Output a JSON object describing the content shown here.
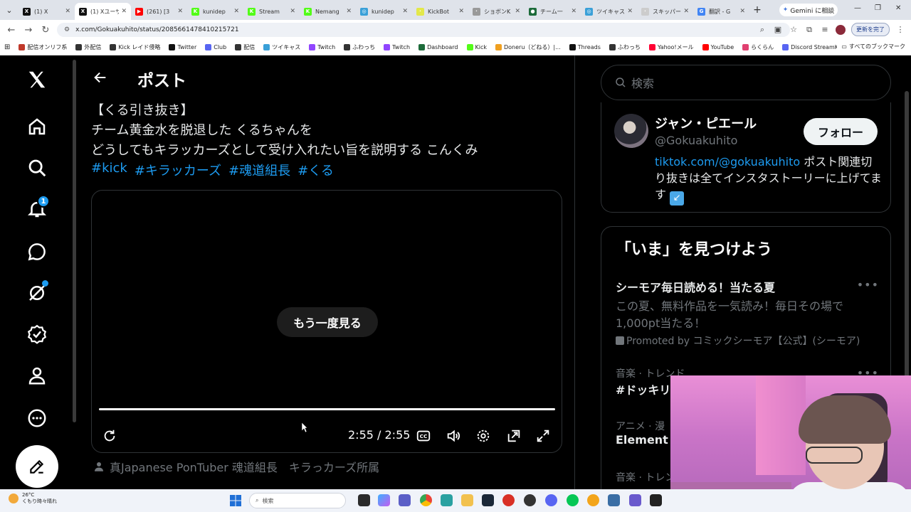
{
  "browser": {
    "tabs": [
      {
        "label": "(1) X",
        "color": "#111111",
        "glyph": "X",
        "active": false
      },
      {
        "label": "(1) Xユーザー",
        "color": "#111111",
        "glyph": "X",
        "active": true
      },
      {
        "label": "(261) [3",
        "color": "#ff0000",
        "glyph": "▶",
        "active": false
      },
      {
        "label": "kunidep",
        "color": "#53fc18",
        "glyph": "K",
        "active": false
      },
      {
        "label": "Stream",
        "color": "#53fc18",
        "glyph": "K",
        "active": false
      },
      {
        "label": "Nemang",
        "color": "#53fc18",
        "glyph": "K",
        "active": false
      },
      {
        "label": "kunidep",
        "color": "#3aa0d8",
        "glyph": "◎",
        "active": false
      },
      {
        "label": "KickBot",
        "color": "#e3e84a",
        "glyph": "·",
        "active": false
      },
      {
        "label": "ショボンK",
        "color": "#999999",
        "glyph": "·",
        "active": false
      },
      {
        "label": "チーム一",
        "color": "#1d6b3a",
        "glyph": "●",
        "active": false
      },
      {
        "label": "ツイキャス",
        "color": "#3aa0d8",
        "glyph": "◎",
        "active": false
      },
      {
        "label": "スキッパー",
        "color": "#cccccc",
        "glyph": "·",
        "active": false
      },
      {
        "label": "翻訳 - G",
        "color": "#4285f4",
        "glyph": "G",
        "active": false
      }
    ],
    "gemini_label": "Gemini に相談",
    "url": "x.com/Gokuakuhito/status/2085661478410215721",
    "update_label": "更新を完了",
    "bookmarks": [
      {
        "label": "配信オンリフ系",
        "color": "#c0392b"
      },
      {
        "label": "外配信",
        "color": "#333333"
      },
      {
        "label": "Kick レイド侵略",
        "color": "#333333"
      },
      {
        "label": "Twitter",
        "color": "#111111"
      },
      {
        "label": "Club",
        "color": "#5865f2"
      },
      {
        "label": "配信",
        "color": "#333333"
      },
      {
        "label": "ツイキャス",
        "color": "#3aa0d8"
      },
      {
        "label": "Twitch",
        "color": "#9146ff"
      },
      {
        "label": "ふわっち",
        "color": "#333333"
      },
      {
        "label": "Twitch",
        "color": "#9146ff"
      },
      {
        "label": "Dashboard",
        "color": "#1d6b3a"
      },
      {
        "label": "Kick",
        "color": "#53fc18"
      },
      {
        "label": "Doneru（どねる）|...",
        "color": "#f0a020"
      },
      {
        "label": "Threads",
        "color": "#111111"
      },
      {
        "label": "ふわっち",
        "color": "#333333"
      },
      {
        "label": "Yahoo!メール",
        "color": "#ff0033"
      },
      {
        "label": "YouTube",
        "color": "#ff0000"
      },
      {
        "label": "らくらん",
        "color": "#e04070"
      },
      {
        "label": "Discord StreamKit O...",
        "color": "#5865f2"
      }
    ],
    "all_bookmarks_label": "すべてのブックマーク"
  },
  "nav": {
    "notification_count": "1"
  },
  "main": {
    "title": "ポスト",
    "post_lines": [
      "【くる引き抜き】",
      "チーム黄金水を脱退した くるちゃんを",
      "どうしてもキラッカーズとして受け入れたい旨を説明する こんくみ"
    ],
    "hashtags": [
      "#kick",
      "#キラッカーズ",
      "#魂道組長",
      "#くる"
    ],
    "video": {
      "replay_label": "もう一度見る",
      "timecode": "2:55 / 2:55",
      "progress": 1.0
    },
    "author_line": "真Japanese PonTuber 魂道組長　キラっカーズ所属"
  },
  "sidebar": {
    "search_placeholder": "検索",
    "profile": {
      "name": "ジャン・ピエール",
      "handle": "@Gokuakuhito",
      "follow_label": "フォロー",
      "bio_link": "tiktok.com/@gokuakuhito",
      "bio_text": " ポスト関連切り抜きは全てインスタストーリーに上げてます",
      "bio_emoji": "↙"
    },
    "trends_title": "「いま」を見つけよう",
    "trends": [
      {
        "category": "",
        "title": "シーモア毎日読める！当たる夏",
        "desc": "この夏、無料作品を一気読み！毎日その場で1,000pt当たる！",
        "promo": "Promoted by コミックシーモア【公式】(シーモア)"
      },
      {
        "category": "音楽 · トレンド",
        "title": "#ドッキリ",
        "desc": "",
        "promo": ""
      },
      {
        "category": "アニメ · 漫",
        "title": "Element S",
        "desc": "",
        "promo": ""
      },
      {
        "category": "音楽 · トレン",
        "title": "",
        "desc": "",
        "promo": ""
      }
    ]
  },
  "taskbar": {
    "temperature": "26°C",
    "weather": "くもり時々晴れ",
    "search_placeholder": "検索"
  }
}
